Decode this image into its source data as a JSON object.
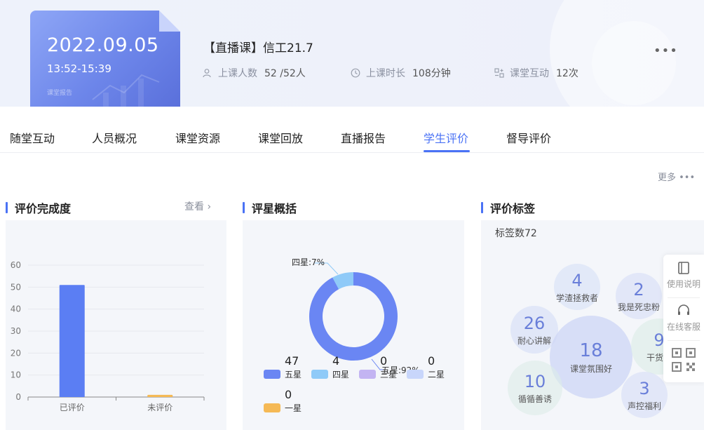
{
  "header": {
    "date": "2022.09.05",
    "time": "13:52-15:39",
    "card_sub": "课堂报告",
    "course_title": "【直播课】信工21.7",
    "stats": [
      {
        "label": "上课人数",
        "value": "52 /52人",
        "icon": "people-icon"
      },
      {
        "label": "上课时长",
        "value": "108分钟",
        "icon": "clock-icon"
      },
      {
        "label": "课堂互动",
        "value": "12次",
        "icon": "interaction-icon"
      }
    ],
    "more": "•••"
  },
  "tabs": [
    {
      "label": "随堂互动"
    },
    {
      "label": "人员概况"
    },
    {
      "label": "课堂资源"
    },
    {
      "label": "课堂回放"
    },
    {
      "label": "直播报告"
    },
    {
      "label": "学生评价",
      "active": true
    },
    {
      "label": "督导评价"
    }
  ],
  "more_link": "更多 •••",
  "panels": {
    "completion": {
      "title": "评价完成度",
      "view": "查看 ›"
    },
    "stars": {
      "title": "评星概括"
    },
    "tags": {
      "title": "评价标签",
      "tag_count": "标签数72"
    }
  },
  "chart_data": [
    {
      "type": "bar",
      "categories": [
        "已评价",
        "未评价"
      ],
      "values": [
        51,
        1
      ],
      "ylim": [
        0,
        60
      ],
      "yticks": [
        0,
        10,
        20,
        30,
        40,
        50,
        60
      ],
      "colors": [
        "#5b7ef3",
        "#f5b955"
      ],
      "grid": true
    },
    {
      "type": "pie",
      "donut": true,
      "slices": [
        {
          "name": "五星",
          "value": 47,
          "color": "#6a86f3"
        },
        {
          "name": "四星",
          "value": 4,
          "color": "#8fcaf8"
        },
        {
          "name": "三星",
          "value": 0,
          "color": "#c3b4f2"
        },
        {
          "name": "二星",
          "value": 0,
          "color": "#c8d6fb"
        },
        {
          "name": "一星",
          "value": 0,
          "color": "#f5b955"
        }
      ],
      "annotations": [
        {
          "text": "四星:7%"
        },
        {
          "text": "五星:92%"
        }
      ]
    }
  ],
  "tag_bubbles": [
    {
      "count": "4",
      "label": "学渣拯救者"
    },
    {
      "count": "2",
      "label": "我是死忠粉"
    },
    {
      "count": "26",
      "label": "耐心讲解"
    },
    {
      "count": "18",
      "label": "课堂氛围好"
    },
    {
      "count": "9",
      "label": "干货满"
    },
    {
      "count": "10",
      "label": "循循善诱"
    },
    {
      "count": "3",
      "label": "声控福利"
    }
  ],
  "side": {
    "manual": "使用说明",
    "service": "在线客服"
  },
  "colors": {
    "accent": "#4a72f5"
  }
}
